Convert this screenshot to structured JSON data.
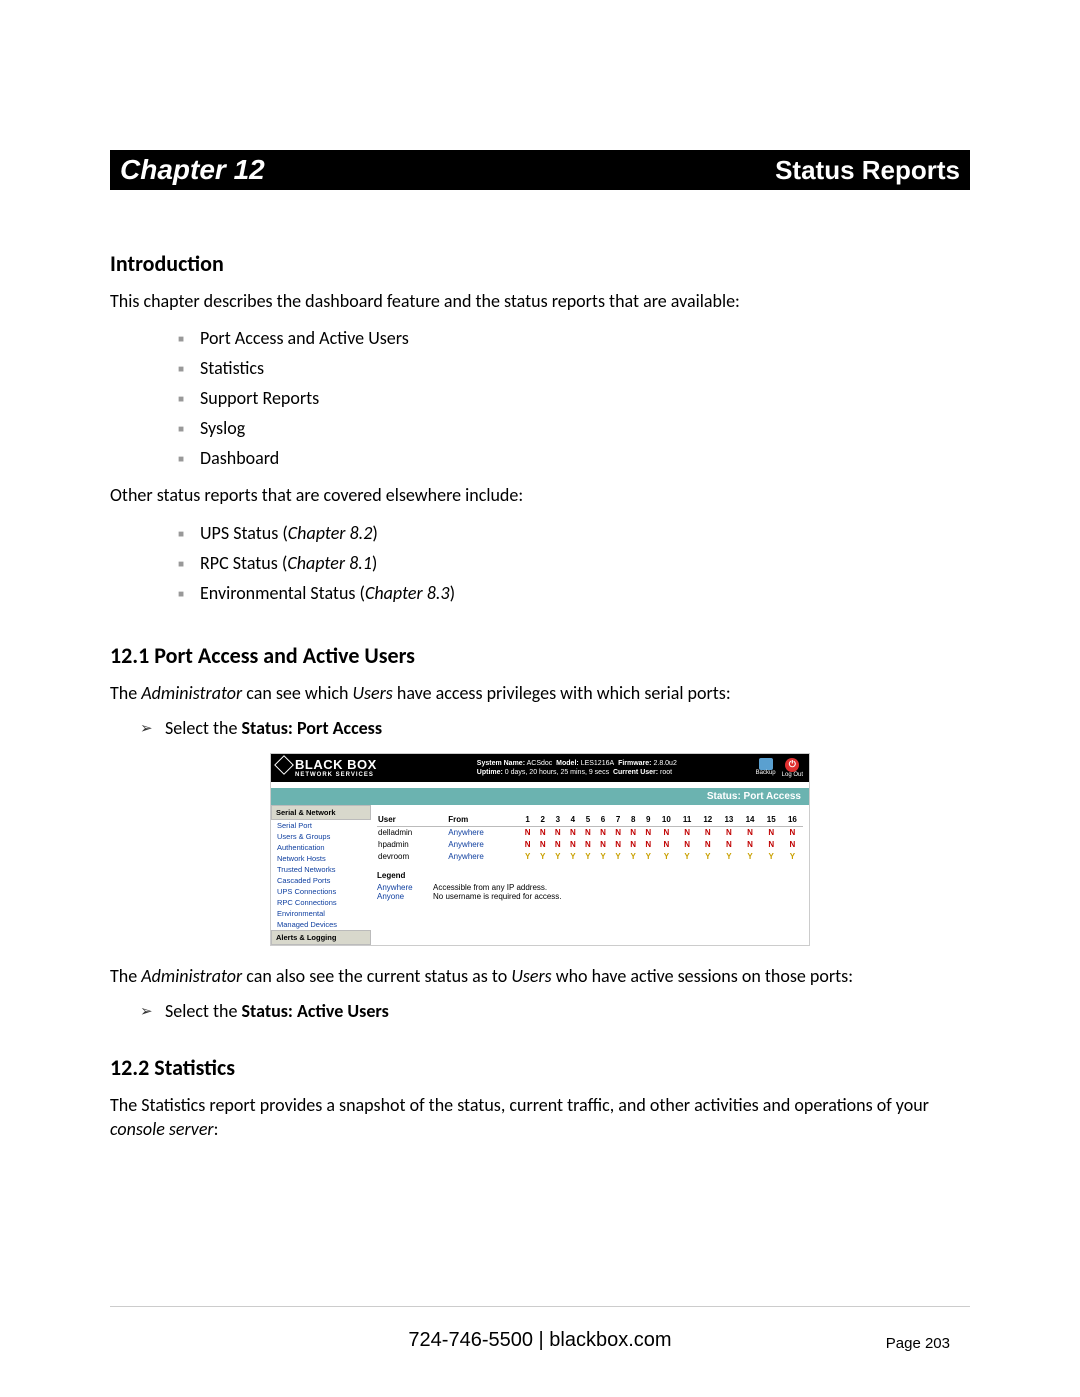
{
  "chapter": {
    "left": "Chapter 12",
    "right": "Status Reports"
  },
  "intro": {
    "heading": "Introduction",
    "lead": "This chapter describes the dashboard feature and the status reports that are available:",
    "items": [
      "Port Access and Active Users",
      "Statistics",
      "Support Reports",
      "Syslog",
      "Dashboard"
    ],
    "other_lead": "Other status reports that are covered elsewhere include:",
    "other_items": [
      {
        "text": "UPS Status (",
        "ref": "Chapter 8.2",
        "after": ")"
      },
      {
        "text": "RPC Status (",
        "ref": "Chapter 8.1",
        "after": ")"
      },
      {
        "text": "Environmental Status (",
        "ref": "Chapter 8.3",
        "after": ")"
      }
    ]
  },
  "s121": {
    "heading": "12.1   Port Access and Active Users",
    "para_pre": "The ",
    "para_admin": "Administrator",
    "para_mid": " can see which ",
    "para_users": "Users",
    "para_post": " have access privileges with which serial ports:",
    "arrow1_pre": "Select the ",
    "arrow1_bold": "Status: Port Access",
    "para2_pre": "The ",
    "para2_admin": "Administrator",
    "para2_mid": " can also see the current status as to ",
    "para2_users": "Users",
    "para2_post": " who have active sessions on those ports:",
    "arrow2_pre": "Select the ",
    "arrow2_bold": "Status: Active Users"
  },
  "s122": {
    "heading": "12.2   Statistics",
    "para_pre": "The Statistics report provides a snapshot of the status, current traffic, and other activities and operations of your ",
    "para_ital": "console server",
    "para_post": ":"
  },
  "screenshot": {
    "logo_top": "BLACK BOX",
    "logo_bottom": "NETWORK SERVICES",
    "sys_line1_labels": [
      "System Name:",
      "Model:",
      "Firmware:"
    ],
    "sys_line1_values": [
      "ACSdoc",
      "LES1216A",
      "2.8.0u2"
    ],
    "sys_line2_labels": [
      "Uptime:",
      "Current User:"
    ],
    "sys_line2_values": [
      "0 days, 20 hours, 25 mins, 9 secs",
      "root"
    ],
    "icon_backup": "Backup",
    "icon_logout": "Log Out",
    "teal_title": "Status: Port Access",
    "side_head1": "Serial & Network",
    "side_links": [
      "Serial Port",
      "Users & Groups",
      "Authentication",
      "Network Hosts",
      "Trusted Networks",
      "Cascaded Ports",
      "UPS Connections",
      "RPC Connections",
      "Environmental",
      "Managed Devices"
    ],
    "side_head2": "Alerts & Logging",
    "table": {
      "col_user": "User",
      "col_from": "From",
      "ports": [
        "1",
        "2",
        "3",
        "4",
        "5",
        "6",
        "7",
        "8",
        "9",
        "10",
        "11",
        "12",
        "13",
        "14",
        "15",
        "16"
      ],
      "rows": [
        {
          "user": "delladmin",
          "from": "Anywhere",
          "vals": [
            "N",
            "N",
            "N",
            "N",
            "N",
            "N",
            "N",
            "N",
            "N",
            "N",
            "N",
            "N",
            "N",
            "N",
            "N",
            "N"
          ]
        },
        {
          "user": "hpadmin",
          "from": "Anywhere",
          "vals": [
            "N",
            "N",
            "N",
            "N",
            "N",
            "N",
            "N",
            "N",
            "N",
            "N",
            "N",
            "N",
            "N",
            "N",
            "N",
            "N"
          ]
        },
        {
          "user": "devroom",
          "from": "Anywhere",
          "vals": [
            "Y",
            "Y",
            "Y",
            "Y",
            "Y",
            "Y",
            "Y",
            "Y",
            "Y",
            "Y",
            "Y",
            "Y",
            "Y",
            "Y",
            "Y",
            "Y"
          ]
        }
      ]
    },
    "legend": {
      "title": "Legend",
      "rows": [
        {
          "k": "Anywhere",
          "v": "Accessible from any IP address."
        },
        {
          "k": "Anyone",
          "v": "No username is required for access."
        }
      ]
    }
  },
  "footer": {
    "phone": "724-746-5500",
    "sep": " | ",
    "site": "blackbox.com",
    "page_label": "Page ",
    "page_num": "203"
  }
}
